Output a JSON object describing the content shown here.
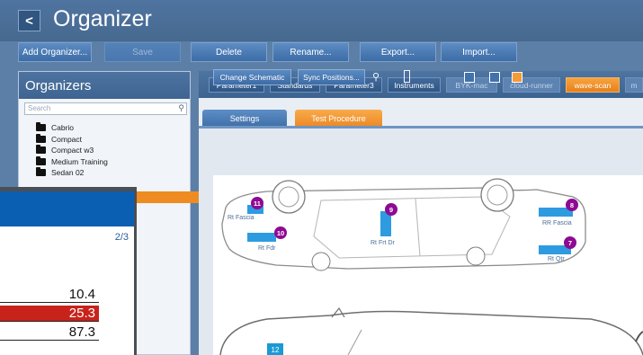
{
  "app": {
    "title": "Organizer"
  },
  "toolbar": [
    {
      "label": "Add Organizer...",
      "enabled": true
    },
    {
      "label": "Save",
      "enabled": false
    },
    {
      "label": "Delete",
      "enabled": true
    },
    {
      "label": "Rename...",
      "enabled": true
    },
    {
      "label": "Export...",
      "enabled": true
    },
    {
      "label": "Import...",
      "enabled": true
    }
  ],
  "organizers": {
    "title": "Organizers",
    "search_placeholder": "Search",
    "items": [
      "Cabrio",
      "Compact",
      "Compact w3",
      "Medium Training",
      "Sedan 02"
    ]
  },
  "param_tabs": [
    {
      "label": "Parameter1",
      "state": "normal"
    },
    {
      "label": "Standards",
      "state": "normal"
    },
    {
      "label": "Parameter3",
      "state": "normal"
    },
    {
      "label": "Instruments",
      "state": "normal"
    },
    {
      "label": "BYK-mac",
      "state": "dim"
    },
    {
      "label": "cloud-runner",
      "state": "dim"
    },
    {
      "label": "wave-scan",
      "state": "active"
    },
    {
      "label": "m",
      "state": "dim"
    }
  ],
  "sub_tabs": [
    {
      "label": "Settings",
      "active": false
    },
    {
      "label": "Test Procedure",
      "active": true
    }
  ],
  "schematic": {
    "change_label": "Change Schematic",
    "sync_label": "Sync Positions...",
    "markers": [
      {
        "num": "11",
        "label": "Rt Fascia"
      },
      {
        "num": "10",
        "label": "Rt Fdr"
      },
      {
        "num": "9",
        "label": "Rt Frt Dr"
      },
      {
        "num": "8",
        "label": "RR Fascia"
      },
      {
        "num": "7",
        "label": "Rt Qtr"
      },
      {
        "num": "12",
        "label": ""
      }
    ]
  },
  "float_window": {
    "page": "2/3",
    "values": [
      "10.4",
      "25.3",
      "87.3"
    ],
    "highlight_color": "#c7231b"
  },
  "colors": {
    "accent": "#ee8c22",
    "marker": "#8e0a93",
    "pad": "#2e9be0"
  }
}
